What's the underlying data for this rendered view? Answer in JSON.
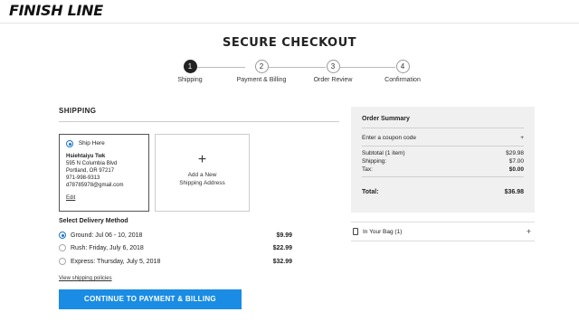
{
  "header": {
    "logo_text": "FINISH LINE"
  },
  "page_title": "SECURE CHECKOUT",
  "steps": [
    {
      "number": "1",
      "label": "Shipping",
      "active": true
    },
    {
      "number": "2",
      "label": "Payment & Billing",
      "active": false
    },
    {
      "number": "3",
      "label": "Order Review",
      "active": false
    },
    {
      "number": "4",
      "label": "Confirmation",
      "active": false
    }
  ],
  "shipping": {
    "title": "SHIPPING",
    "address_card": {
      "ship_here_label": "Ship Here",
      "name": "Hsiehtaiyu Twk",
      "street": "595 N Columbia Blvd",
      "city_line": "Portland, OR 97217",
      "phone": "971-998-9313",
      "email": "d78785978@gmail.com",
      "edit_label": "Edit"
    },
    "new_address": {
      "plus": "+",
      "line1": "Add a New",
      "line2": "Shipping Address"
    },
    "delivery_title": "Select Delivery Method",
    "delivery_options": [
      {
        "label": "Ground: Jul 06 - 10, 2018",
        "price": "$9.99",
        "selected": true
      },
      {
        "label": "Rush: Friday, July 6, 2018",
        "price": "$22.99",
        "selected": false
      },
      {
        "label": "Express: Thursday, July 5, 2018",
        "price": "$32.99",
        "selected": false
      }
    ],
    "policies_link": "View shipping policies",
    "continue_button": "CONTINUE TO PAYMENT & BILLING"
  },
  "summary": {
    "title": "Order Summary",
    "coupon_label": "Enter a coupon code",
    "coupon_plus": "+",
    "subtotal_label": "Subtotal (1 item)",
    "subtotal_value": "$29.98",
    "shipping_label": "Shipping:",
    "shipping_value": "$7.00",
    "tax_label": "Tax:",
    "tax_value": "$0.00",
    "total_label": "Total:",
    "total_value": "$36.98"
  },
  "bag": {
    "label": "In Your Bag (1)",
    "plus": "+"
  },
  "colors": {
    "accent": "#1a8ce3",
    "radio": "#1a73c8",
    "summary_bg": "#f0f0f0"
  }
}
